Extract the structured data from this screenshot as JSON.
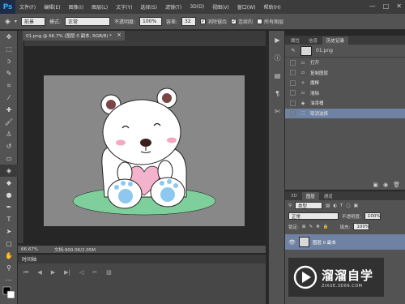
{
  "app": {
    "logo": "Ps"
  },
  "menu": [
    "文件(F)",
    "编辑(E)",
    "图像(I)",
    "图层(L)",
    "文字(Y)",
    "选择(S)",
    "滤镜(T)",
    "3D(D)",
    "视图(V)",
    "窗口(W)",
    "帮助(H)"
  ],
  "window_controls": {
    "minimize": "—",
    "maximize": "□",
    "close": "✕"
  },
  "options": {
    "fill_source": "前景",
    "mode_label": "模式:",
    "mode_value": "正常",
    "opacity_label": "不透明度:",
    "opacity_value": "100%",
    "tolerance_label": "容差:",
    "tolerance_value": "32",
    "antialias_label": "消除锯齿",
    "contiguous_label": "连续的",
    "all_layers_label": "所有图层"
  },
  "document": {
    "tab_title": "01.png @ 66.7% (图层 0 副本, RGB/8) *",
    "close": "×"
  },
  "status": {
    "zoom": "66.67%",
    "doc_info": "文档:900.0K/2.05M"
  },
  "timeline": {
    "title": "时间轴"
  },
  "history_panel": {
    "tabs": [
      "属性",
      "信息",
      "历史记录"
    ],
    "snapshot_name": "01.png",
    "items": [
      "打开",
      "复制图层",
      "魔棒",
      "清除",
      "油漆桶",
      "取消选择"
    ]
  },
  "layers_panel": {
    "tabs": [
      "3D",
      "图层",
      "通道"
    ],
    "filter_kind": "类型",
    "blend_mode": "正常",
    "opacity_label": "不透明度:",
    "opacity_value": "100%",
    "lock_label": "锁定:",
    "fill_label": "填充:",
    "fill_value": "100%",
    "layer_name": "图层 0 副本"
  },
  "watermark": {
    "main": "溜溜自学",
    "sub": "ZIXUE.3D66.COM"
  },
  "colors": {
    "menu_bg": "#3c3c3c",
    "panel_bg": "#535353",
    "canvas_bg": "#888888",
    "selection": "#6f82a3",
    "ground": "#7fcf9c",
    "heart": "#f4b3cc",
    "paw": "#8ec8ee"
  }
}
